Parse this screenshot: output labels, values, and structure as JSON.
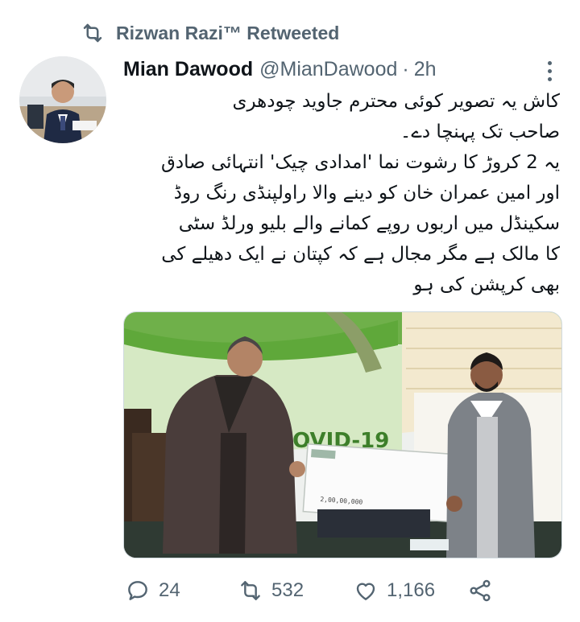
{
  "social_context": {
    "retweeter": "Rizwan Razi™ Retweeted",
    "icon": "retweet-icon"
  },
  "author": {
    "name": "Mian Dawood",
    "handle": "@MianDawood",
    "separator": "·",
    "time": "2h"
  },
  "tweet": {
    "lines": [
      "کاش یہ تصویر کوئی محترم جاوید چودھری",
      "صاحب تک پہنچا دے۔",
      "یہ 2 کروڑ کا رشوت نما 'امدادی چیک' انتہائی صادق",
      "اور امین عمران خان کو دینے والا راولپنڈی رنگ روڈ",
      "سکینڈل میں اربوں روپے کمانے والے بلیو ورلڈ سٹی",
      "کا مالک ہے مگر مجال ہے کہ کپتان نے ایک دھیلے کی",
      "بھی کرپشن کی ہو"
    ]
  },
  "media": {
    "banner_text": "COVID-19",
    "cheque_amount_line": "2,00,00,000"
  },
  "actions": {
    "replies": "24",
    "retweets": "532",
    "likes": "1,166",
    "icons": [
      "reply-icon",
      "retweet-icon",
      "like-icon",
      "share-icon"
    ]
  },
  "colors": {
    "text_primary": "#0f1419",
    "text_secondary": "#536471",
    "banner_green": "#5fa83a"
  }
}
